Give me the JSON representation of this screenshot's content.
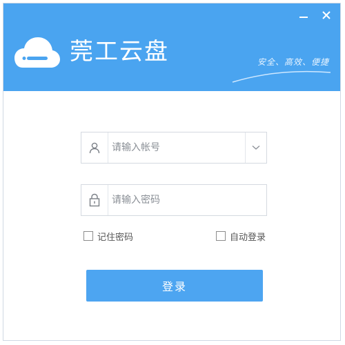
{
  "window": {
    "controls": {
      "minimize_icon": "minimize-icon",
      "close_icon": "close-icon"
    }
  },
  "header": {
    "logo_icon": "cloud-icon",
    "app_title": "莞工云盘",
    "slogan": "安全、高效、便捷",
    "background_color": "#4aa4f0"
  },
  "form": {
    "account": {
      "icon": "user-icon",
      "placeholder": "请输入帐号",
      "value": "",
      "dropdown_icon": "chevron-down-icon"
    },
    "password": {
      "icon": "lock-icon",
      "placeholder": "请输入密码",
      "value": ""
    },
    "remember_password": {
      "label": "记住密码",
      "checked": false
    },
    "auto_login": {
      "label": "自动登录",
      "checked": false
    },
    "login_button": {
      "label": "登录",
      "color": "#4da5f1"
    }
  }
}
